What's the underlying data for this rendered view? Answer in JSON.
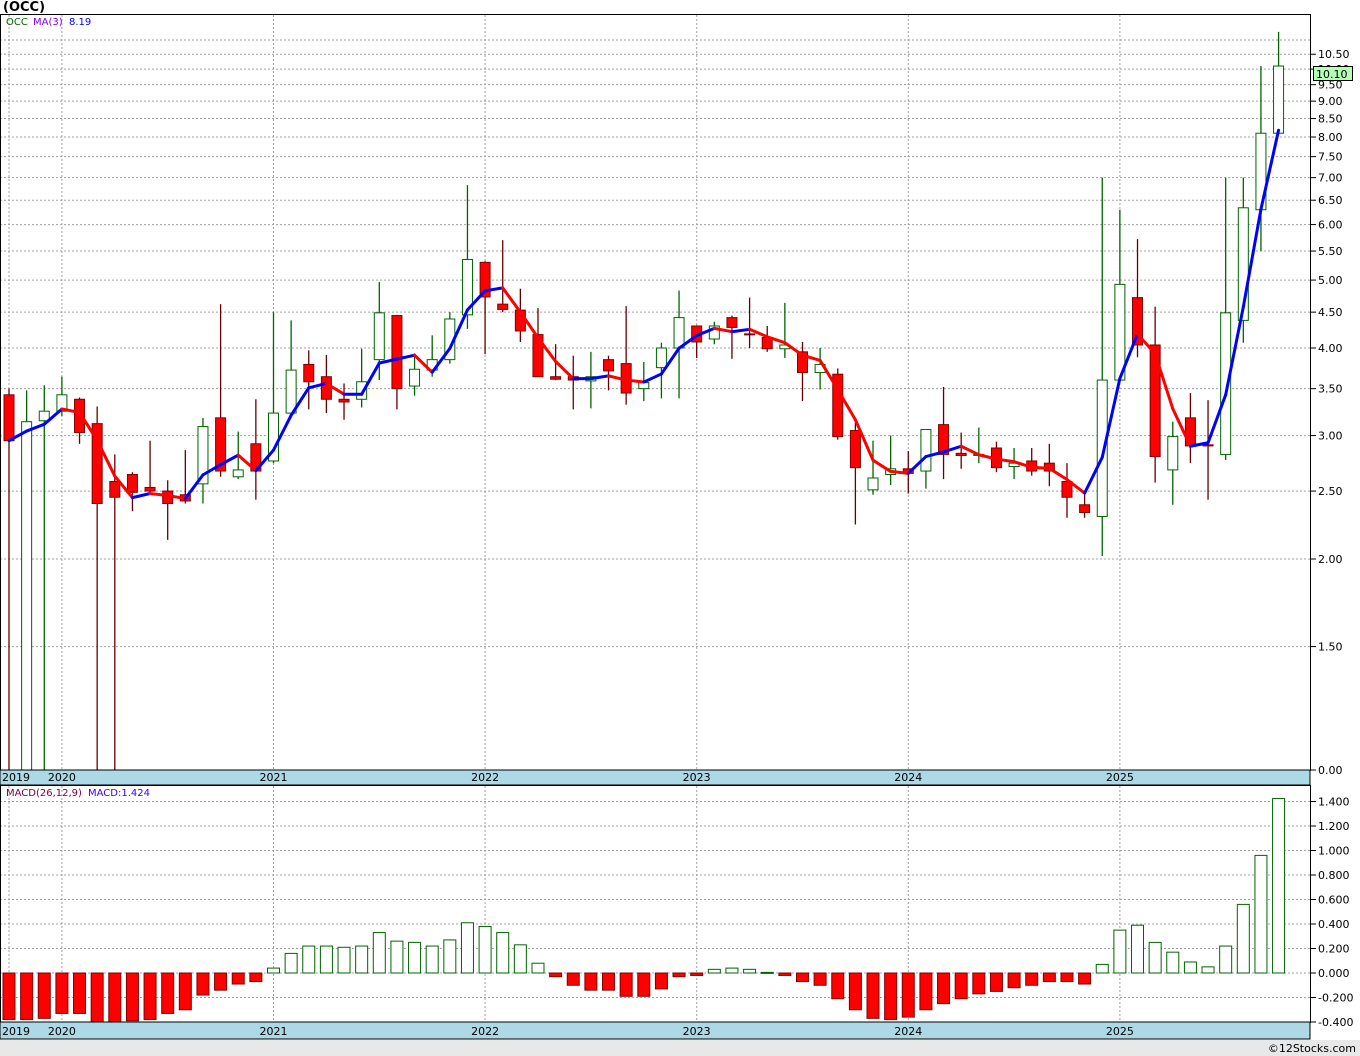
{
  "header": {
    "title": "(OCC)"
  },
  "main_legend": {
    "symbol": "OCC",
    "indicator": "MA(3)",
    "value": "8.19"
  },
  "macd_legend": {
    "indicator": "MACD(26,12,9)",
    "value": "MACD:1.424"
  },
  "last_price": "10.10",
  "footer": {
    "copyright": "©12Stocks.com"
  },
  "colors": {
    "up": "#006400",
    "down": "#ff0000",
    "down_border": "#800000",
    "ma_up": "#0000ff",
    "ma_down": "#ff0000",
    "date_bar": "#add8e6",
    "last_price_badge": "#b3ffb3"
  },
  "chart_data": [
    {
      "type": "candlestick",
      "interval": "monthly",
      "y_scale": "log",
      "y_ticks": [
        "10.50",
        "10.00",
        "9.50",
        "9.00",
        "8.50",
        "8.00",
        "7.50",
        "7.00",
        "6.50",
        "6.00",
        "5.50",
        "5.00",
        "4.50",
        "4.00",
        "3.50",
        "3.00",
        "2.50",
        "2.00",
        "1.50",
        "0.00"
      ],
      "x_labels": [
        "2019",
        "2020",
        "2021",
        "2022",
        "2023",
        "2024",
        "2025"
      ],
      "grid": true,
      "overlay": {
        "name": "MA(3)",
        "period": 3
      },
      "columns": [
        "date",
        "open",
        "high",
        "low",
        "close"
      ],
      "candles": [
        [
          "2019-10",
          3.43,
          3.5,
          0,
          2.95
        ],
        [
          "2019-11",
          0,
          3.48,
          0,
          3.14
        ],
        [
          "2019-12",
          3.15,
          3.54,
          0,
          3.25
        ],
        [
          "2020-01",
          3.25,
          3.64,
          3.2,
          3.43
        ],
        [
          "2020-02",
          3.38,
          3.4,
          2.92,
          3.03
        ],
        [
          "2020-03",
          3.12,
          3.3,
          0,
          2.4
        ],
        [
          "2020-04",
          2.58,
          2.82,
          0,
          2.45
        ],
        [
          "2020-05",
          2.64,
          2.66,
          2.34,
          2.49
        ],
        [
          "2020-06",
          2.53,
          2.95,
          2.49,
          2.5
        ],
        [
          "2020-07",
          2.5,
          2.59,
          2.13,
          2.4
        ],
        [
          "2020-08",
          2.47,
          2.86,
          2.4,
          2.42
        ],
        [
          "2020-09",
          2.56,
          3.18,
          2.4,
          3.09
        ],
        [
          "2020-10",
          3.18,
          4.62,
          2.62,
          2.67
        ],
        [
          "2020-11",
          2.62,
          3.04,
          2.6,
          2.68
        ],
        [
          "2020-12",
          2.92,
          3.38,
          2.43,
          2.67
        ],
        [
          "2021-01",
          2.76,
          4.5,
          2.74,
          3.23
        ],
        [
          "2021-02",
          3.23,
          4.38,
          3.22,
          3.72
        ],
        [
          "2021-03",
          3.79,
          3.97,
          3.27,
          3.58
        ],
        [
          "2021-04",
          3.64,
          3.91,
          3.23,
          3.38
        ],
        [
          "2021-05",
          3.38,
          3.56,
          3.16,
          3.35
        ],
        [
          "2021-06",
          3.38,
          3.99,
          3.29,
          3.58
        ],
        [
          "2021-07",
          3.85,
          4.97,
          3.6,
          4.49
        ],
        [
          "2021-08",
          4.45,
          4.46,
          3.27,
          3.5
        ],
        [
          "2021-09",
          3.53,
          3.93,
          3.42,
          3.73
        ],
        [
          "2021-10",
          3.72,
          4.17,
          3.64,
          3.85
        ],
        [
          "2021-11",
          3.85,
          4.5,
          3.8,
          4.4
        ],
        [
          "2021-12",
          4.46,
          6.83,
          4.26,
          5.35
        ],
        [
          "2022-01",
          5.3,
          5.32,
          3.92,
          4.73
        ],
        [
          "2022-02",
          4.62,
          5.7,
          4.5,
          4.54
        ],
        [
          "2022-03",
          4.53,
          4.86,
          4.08,
          4.23
        ],
        [
          "2022-04",
          4.18,
          4.56,
          3.64,
          3.64
        ],
        [
          "2022-05",
          3.64,
          4.05,
          3.6,
          3.61
        ],
        [
          "2022-06",
          3.64,
          3.9,
          3.27,
          3.6
        ],
        [
          "2022-07",
          3.59,
          3.95,
          3.28,
          3.64
        ],
        [
          "2022-08",
          3.85,
          3.9,
          3.48,
          3.71
        ],
        [
          "2022-09",
          3.8,
          4.59,
          3.32,
          3.45
        ],
        [
          "2022-10",
          3.5,
          3.82,
          3.36,
          3.57
        ],
        [
          "2022-11",
          3.75,
          4.07,
          3.39,
          4.0
        ],
        [
          "2022-12",
          4.0,
          4.83,
          3.39,
          4.42
        ],
        [
          "2023-01",
          4.3,
          4.31,
          3.87,
          4.08
        ],
        [
          "2023-02",
          4.12,
          4.36,
          4.05,
          4.3
        ],
        [
          "2023-03",
          4.42,
          4.45,
          3.86,
          4.28
        ],
        [
          "2023-04",
          4.19,
          4.72,
          4.0,
          4.18
        ],
        [
          "2023-05",
          4.14,
          4.3,
          3.95,
          3.99
        ],
        [
          "2023-06",
          3.99,
          4.64,
          3.87,
          4.04
        ],
        [
          "2023-07",
          3.95,
          4.08,
          3.36,
          3.69
        ],
        [
          "2023-08",
          3.69,
          4.0,
          3.49,
          3.79
        ],
        [
          "2023-09",
          3.67,
          3.74,
          2.96,
          2.99
        ],
        [
          "2023-10",
          3.05,
          3.13,
          2.24,
          2.7
        ],
        [
          "2023-11",
          2.51,
          2.95,
          2.47,
          2.61
        ],
        [
          "2023-12",
          2.64,
          3.0,
          2.55,
          2.69
        ],
        [
          "2024-01",
          2.69,
          2.85,
          2.48,
          2.65
        ],
        [
          "2024-02",
          2.67,
          3.06,
          2.52,
          3.06
        ],
        [
          "2024-03",
          3.11,
          3.52,
          2.6,
          2.82
        ],
        [
          "2024-04",
          2.83,
          3.03,
          2.69,
          2.81
        ],
        [
          "2024-05",
          2.81,
          3.08,
          2.74,
          2.82
        ],
        [
          "2024-06",
          2.88,
          2.94,
          2.66,
          2.7
        ],
        [
          "2024-07",
          2.71,
          2.88,
          2.6,
          2.74
        ],
        [
          "2024-08",
          2.76,
          2.88,
          2.63,
          2.67
        ],
        [
          "2024-09",
          2.74,
          2.92,
          2.54,
          2.67
        ],
        [
          "2024-10",
          2.58,
          2.74,
          2.29,
          2.45
        ],
        [
          "2024-11",
          2.39,
          2.48,
          2.29,
          2.33
        ],
        [
          "2024-12",
          2.3,
          7.0,
          2.02,
          3.6
        ],
        [
          "2025-01",
          3.6,
          6.3,
          3.6,
          4.93
        ],
        [
          "2025-02",
          4.72,
          5.72,
          3.88,
          4.04
        ],
        [
          "2025-03",
          4.04,
          4.58,
          2.57,
          2.8
        ],
        [
          "2025-04",
          2.68,
          3.14,
          2.39,
          2.99
        ],
        [
          "2025-05",
          3.18,
          3.45,
          2.74,
          2.9
        ],
        [
          "2025-06",
          2.91,
          3.37,
          2.43,
          2.9
        ],
        [
          "2025-07",
          2.82,
          7.0,
          2.77,
          4.49
        ],
        [
          "2025-08",
          4.38,
          7.0,
          4.07,
          6.34
        ],
        [
          "2025-09",
          6.3,
          10.1,
          5.5,
          8.1
        ],
        [
          "2025-10",
          8.1,
          11.3,
          8.1,
          10.1
        ]
      ]
    },
    {
      "type": "bar",
      "name": "MACD(26,12,9)",
      "y_ticks": [
        "1.400",
        "1.200",
        "1.000",
        "0.800",
        "0.600",
        "0.400",
        "0.200",
        "0.000",
        "-0.200",
        "-0.400"
      ],
      "ylim": [
        -0.4,
        1.5
      ],
      "values": [
        -0.38,
        -0.38,
        -0.37,
        -0.33,
        -0.33,
        -0.4,
        -0.41,
        -0.39,
        -0.38,
        -0.33,
        -0.3,
        -0.18,
        -0.14,
        -0.09,
        -0.07,
        0.04,
        0.16,
        0.22,
        0.22,
        0.21,
        0.22,
        0.33,
        0.26,
        0.25,
        0.22,
        0.27,
        0.41,
        0.38,
        0.33,
        0.23,
        0.08,
        -0.03,
        -0.1,
        -0.14,
        -0.14,
        -0.19,
        -0.19,
        -0.13,
        -0.03,
        -0.02,
        0.03,
        0.04,
        0.03,
        0.005,
        -0.02,
        -0.07,
        -0.1,
        -0.21,
        -0.3,
        -0.37,
        -0.38,
        -0.36,
        -0.3,
        -0.25,
        -0.21,
        -0.17,
        -0.15,
        -0.12,
        -0.1,
        -0.07,
        -0.07,
        -0.09,
        0.07,
        0.35,
        0.39,
        0.25,
        0.17,
        0.09,
        0.05,
        0.22,
        0.56,
        0.96,
        1.424
      ]
    }
  ]
}
